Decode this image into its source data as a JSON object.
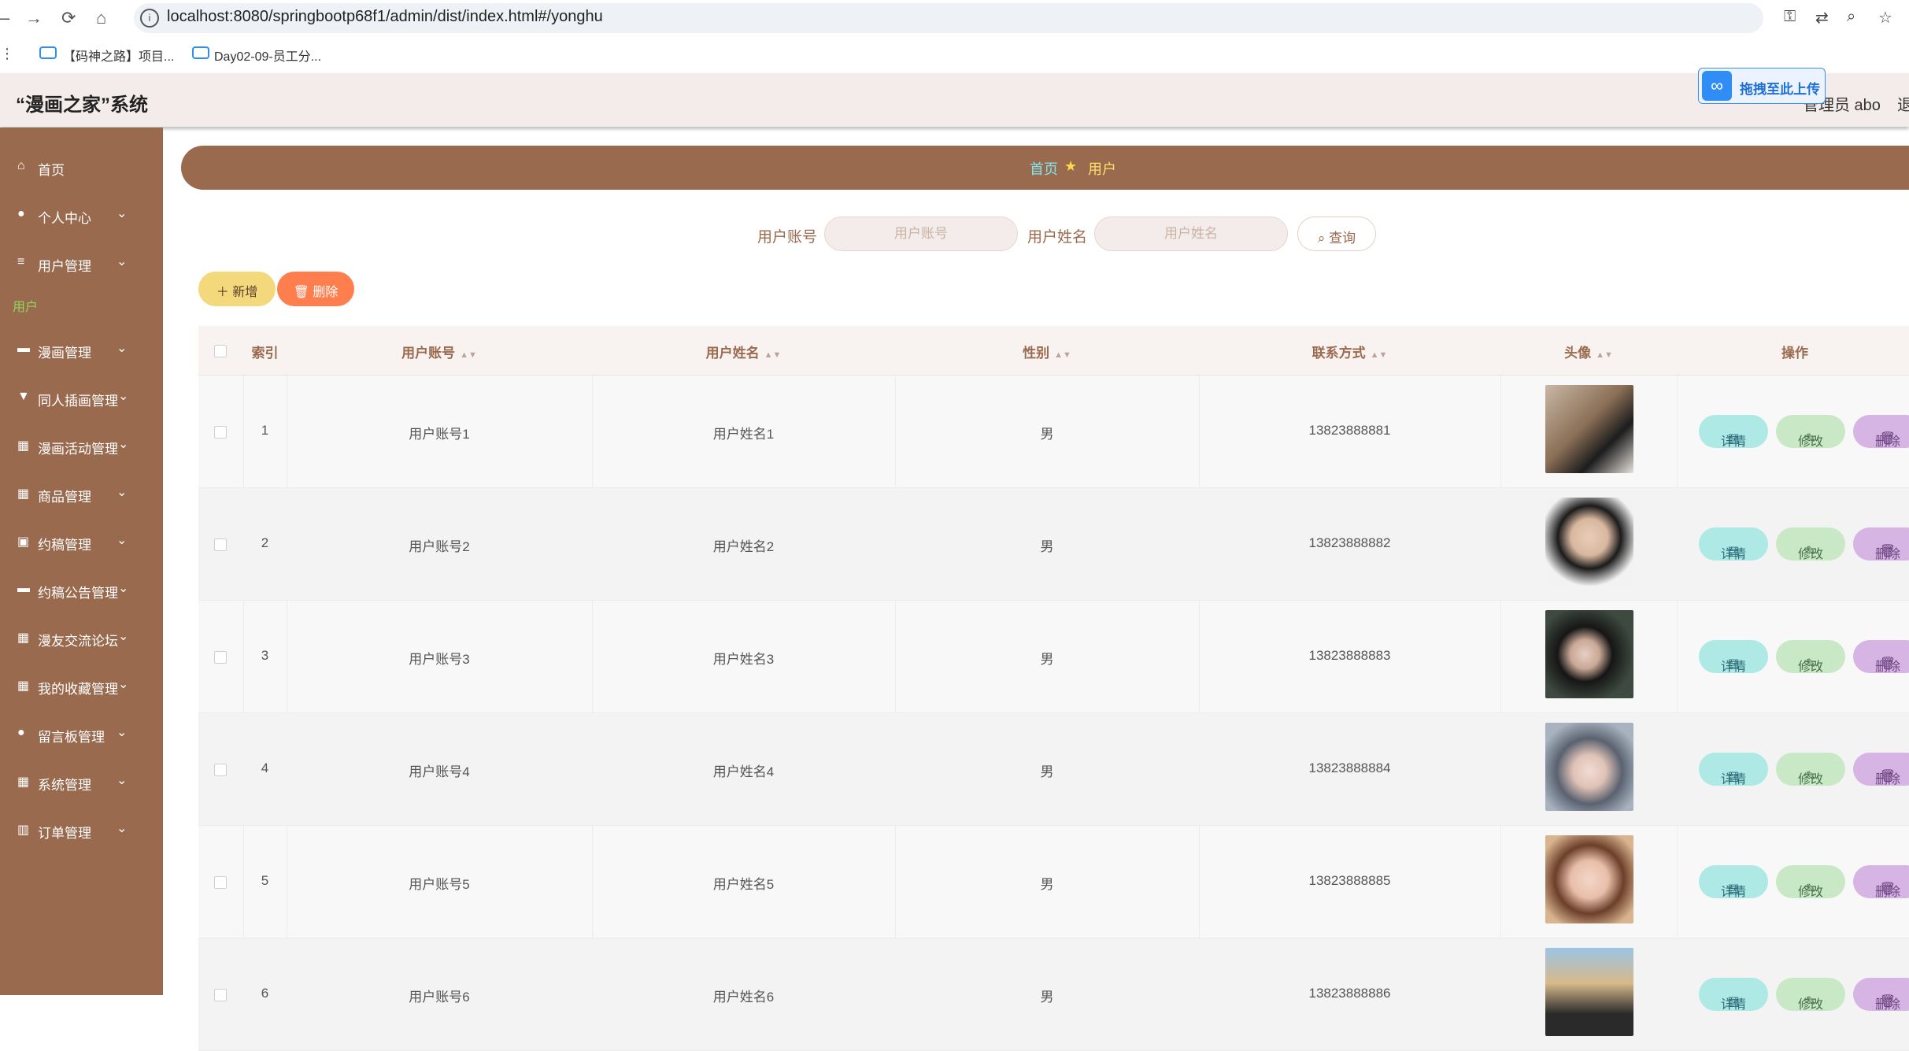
{
  "browser": {
    "url": "localhost:8080/springbootp68f1/admin/dist/index.html#/yonghu",
    "bookmarks": [
      "【码神之路】项目...",
      "Day02-09-员工分..."
    ]
  },
  "header": {
    "title": "“漫画之家”系统",
    "user": "管理员 abo",
    "logout": "退",
    "upload_widget": "拖拽至此上传"
  },
  "sidebar": {
    "items": [
      {
        "label": "首页",
        "icon": "home-icon"
      },
      {
        "label": "个人中心",
        "icon": "user-icon"
      },
      {
        "label": "用户管理",
        "icon": "menu-icon"
      },
      {
        "label": "漫画管理",
        "icon": "book-icon"
      },
      {
        "label": "同人插画管理",
        "icon": "brush-icon"
      },
      {
        "label": "漫画活动管理",
        "icon": "grid-icon"
      },
      {
        "label": "商品管理",
        "icon": "grid-icon"
      },
      {
        "label": "约稿管理",
        "icon": "doc-icon"
      },
      {
        "label": "约稿公告管理",
        "icon": "monitor-icon"
      },
      {
        "label": "漫友交流论坛",
        "icon": "grid-icon"
      },
      {
        "label": "我的收藏管理",
        "icon": "grid-icon"
      },
      {
        "label": "留言板管理",
        "icon": "user-icon"
      },
      {
        "label": "系统管理",
        "icon": "grid-icon"
      },
      {
        "label": "订单管理",
        "icon": "chart-icon"
      }
    ],
    "active_sub": "用户"
  },
  "breadcrumb": {
    "home": "首页",
    "current": "用户"
  },
  "search": {
    "account_label": "用户账号",
    "account_placeholder": "用户账号",
    "name_label": "用户姓名",
    "name_placeholder": "用户姓名",
    "query_button": "查询"
  },
  "actions": {
    "add": "新增",
    "delete": "删除"
  },
  "table": {
    "headers": [
      "索引",
      "用户账号",
      "用户姓名",
      "性别",
      "联系方式",
      "头像",
      "操作"
    ],
    "row_buttons": {
      "detail": "详情",
      "edit": "修改",
      "delete": "删除"
    },
    "rows": [
      {
        "index": "1",
        "account": "用户账号1",
        "name": "用户姓名1",
        "gender": "男",
        "phone": "13823888881"
      },
      {
        "index": "2",
        "account": "用户账号2",
        "name": "用户姓名2",
        "gender": "男",
        "phone": "13823888882"
      },
      {
        "index": "3",
        "account": "用户账号3",
        "name": "用户姓名3",
        "gender": "男",
        "phone": "13823888883"
      },
      {
        "index": "4",
        "account": "用户账号4",
        "name": "用户姓名4",
        "gender": "男",
        "phone": "13823888884"
      },
      {
        "index": "5",
        "account": "用户账号5",
        "name": "用户姓名5",
        "gender": "男",
        "phone": "13823888885"
      },
      {
        "index": "6",
        "account": "用户账号6",
        "name": "用户姓名6",
        "gender": "男",
        "phone": "13823888886"
      }
    ]
  },
  "colors": {
    "brand": "#9a6a4e",
    "header_bg": "#f3ecea",
    "add_btn": "#f4d97c",
    "delete_btn": "#ff7e4e"
  }
}
